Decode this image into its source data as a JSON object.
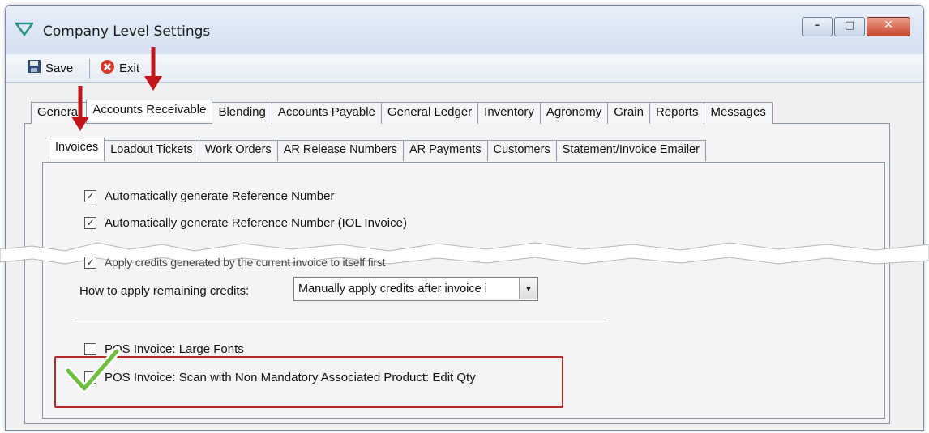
{
  "window": {
    "title": "Company Level Settings",
    "controls": {
      "minimize": "–",
      "maximize": "□",
      "close": "✕"
    }
  },
  "toolbar": {
    "save_label": "Save",
    "exit_label": "Exit"
  },
  "main_tabs": [
    "General",
    "Accounts Receivable",
    "Blending",
    "Accounts Payable",
    "General Ledger",
    "Inventory",
    "Agronomy",
    "Grain",
    "Reports",
    "Messages"
  ],
  "main_active_tab": "Accounts Receivable",
  "sub_tabs": [
    "Invoices",
    "Loadout Tickets",
    "Work Orders",
    "AR Release Numbers",
    "AR Payments",
    "Customers",
    "Statement/Invoice Emailer"
  ],
  "sub_active_tab": "Invoices",
  "settings": {
    "auto_ref": {
      "label": "Automatically generate Reference Number",
      "checked": true
    },
    "auto_ref_iol": {
      "label": "Automatically generate Reference Number (IOL Invoice)",
      "checked": true
    },
    "apply_credits": {
      "label": "Apply credits generated by the current invoice to itself first",
      "checked": true
    },
    "remaining_credits": {
      "label": "How to apply remaining credits:",
      "value": "Manually apply credits after invoice i"
    },
    "pos_large_fonts": {
      "label": "POS Invoice: Large Fonts",
      "checked": false
    },
    "pos_scan_non_mandatory": {
      "label": "POS Invoice: Scan with Non Mandatory Associated Product: Edit Qty",
      "checked": true
    }
  },
  "colors": {
    "annotation_red": "#b62727",
    "checkmark_green": "#6fbf3f",
    "window_frame": "#dfe8f3"
  },
  "icons": [
    "app-logo-icon",
    "save-disk-icon",
    "exit-x-icon",
    "dropdown-arrow-icon",
    "checkmark-annotation-icon",
    "down-arrow-annotation-icon"
  ]
}
